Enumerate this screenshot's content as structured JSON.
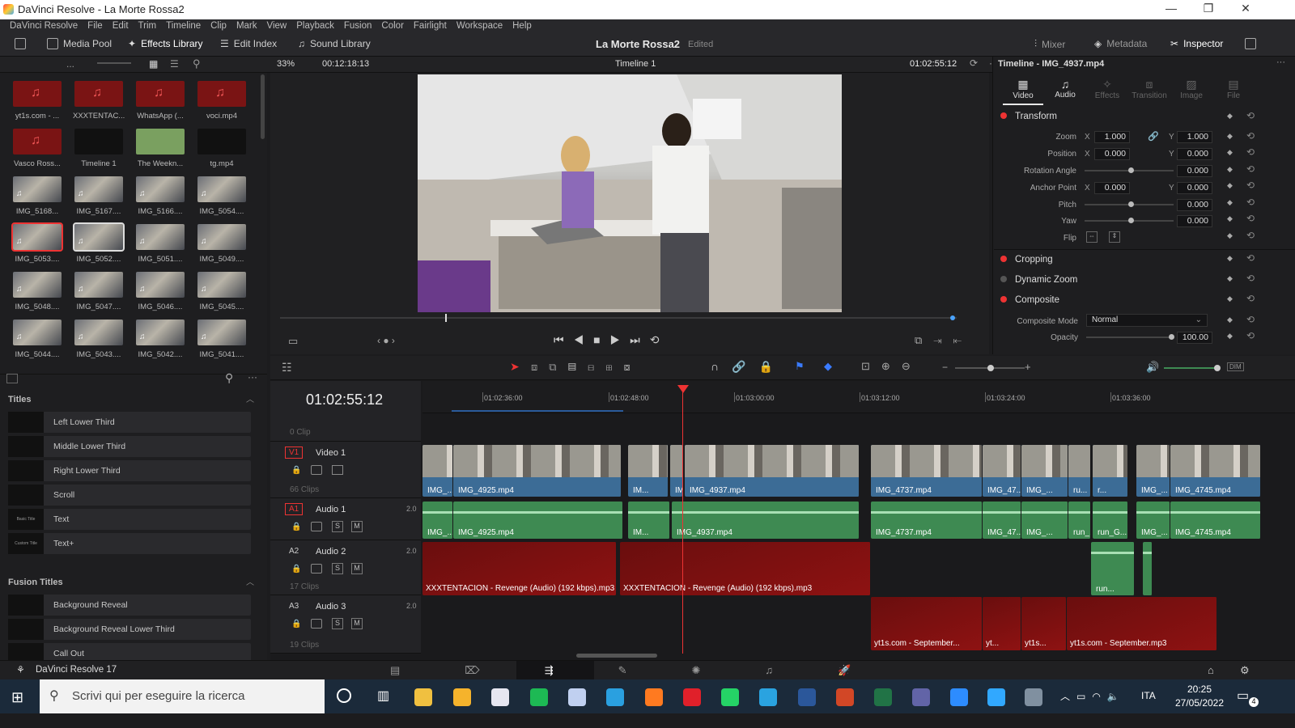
{
  "window": {
    "title": "DaVinci Resolve - La Morte Rossa2",
    "min": "—",
    "max": "❐",
    "close": "✕"
  },
  "menu": [
    "DaVinci Resolve",
    "File",
    "Edit",
    "Trim",
    "Timeline",
    "Clip",
    "Mark",
    "View",
    "Playback",
    "Fusion",
    "Color",
    "Fairlight",
    "Workspace",
    "Help"
  ],
  "toolbar": {
    "media_pool": "Media Pool",
    "effects_library": "Effects Library",
    "edit_index": "Edit Index",
    "sound_library": "Sound Library",
    "project": "La Morte Rossa2",
    "status": "Edited",
    "mixer": "Mixer",
    "metadata": "Metadata",
    "inspector": "Inspector"
  },
  "viewer": {
    "zoom": "33%",
    "duration": "00:12:18:13",
    "timeline_name": "Timeline 1",
    "timecode": "01:02:55:12"
  },
  "inspector": {
    "clip_title": "Timeline - IMG_4937.mp4",
    "tabs": [
      "Video",
      "Audio",
      "Effects",
      "Transition",
      "Image",
      "File"
    ],
    "transform": "Transform",
    "zoom_label": "Zoom",
    "zoom_x": "1.000",
    "zoom_y": "1.000",
    "position_label": "Position",
    "pos_x": "0.000",
    "pos_y": "0.000",
    "rotation_label": "Rotation Angle",
    "rotation": "0.000",
    "anchor_label": "Anchor Point",
    "anchor_x": "0.000",
    "anchor_y": "0.000",
    "pitch_label": "Pitch",
    "pitch": "0.000",
    "yaw_label": "Yaw",
    "yaw": "0.000",
    "flip_label": "Flip",
    "cropping": "Cropping",
    "dynamic_zoom": "Dynamic Zoom",
    "composite": "Composite",
    "composite_mode_label": "Composite Mode",
    "composite_mode": "Normal",
    "opacity_label": "Opacity",
    "opacity": "100.00",
    "x": "X",
    "y": "Y"
  },
  "media": [
    [
      "yt1s.com - ...",
      "XXXTENTAC...",
      "WhatsApp (...",
      "voci.mp4"
    ],
    [
      "Vasco Ross...",
      "Timeline 1",
      "The Weekn...",
      "tg.mp4"
    ],
    [
      "IMG_5168...",
      "IMG_5167....",
      "IMG_5166....",
      "IMG_5054...."
    ],
    [
      "IMG_5053....",
      "IMG_5052....",
      "IMG_5051....",
      "IMG_5049...."
    ],
    [
      "IMG_5048....",
      "IMG_5047....",
      "IMG_5046....",
      "IMG_5045...."
    ],
    [
      "IMG_5044....",
      "IMG_5043....",
      "IMG_5042....",
      "IMG_5041...."
    ]
  ],
  "effects": {
    "titles_header": "Titles",
    "titles": [
      "Left Lower Third",
      "Middle Lower Third",
      "Right Lower Third",
      "Scroll",
      "Text",
      "Text+"
    ],
    "swatches": [
      "",
      "",
      "",
      "",
      "Basic Title",
      "Custom Title"
    ],
    "fusion_header": "Fusion Titles",
    "fusion": [
      "Background Reveal",
      "Background Reveal Lower Third",
      "Call Out"
    ]
  },
  "timeline": {
    "timecode": "01:02:55:12",
    "ruler": [
      "01:02:36:00",
      "01:02:48:00",
      "01:03:00:00",
      "01:03:12:00",
      "01:03:24:00",
      "01:03:36:00"
    ],
    "zero_clip": "0 Clip",
    "tracks": [
      {
        "id": "V1",
        "name": "Video 1",
        "count": "66 Clips",
        "level": ""
      },
      {
        "id": "A1",
        "name": "Audio 1",
        "count": "",
        "level": "2.0"
      },
      {
        "id": "A2",
        "name": "Audio 2",
        "count": "17 Clips",
        "level": "2.0"
      },
      {
        "id": "A3",
        "name": "Audio 3",
        "count": "19 Clips",
        "level": "2.0"
      }
    ],
    "video_clips": [
      "IMG_...",
      "IMG_4925.mp4",
      "IM...",
      "IM...",
      "IMG_4937.mp4",
      "IMG_4737.mp4",
      "IMG_47...",
      "IMG_...",
      "ru...",
      "r...",
      "IMG_...",
      "IMG_4745.mp4"
    ],
    "audio1_clips": [
      "IMG_...",
      "IMG_4925.mp4",
      "IM...",
      "IMG_4937.mp4",
      "IMG_4737.mp4",
      "IMG_47...",
      "IMG_...",
      "run_...",
      "run_G...",
      "IMG_...",
      "IMG_4745.mp4"
    ],
    "audio2_clips": [
      "XXXTENTACION - Revenge (Audio) (192 kbps).mp3",
      "XXXTENTACION - Revenge (Audio) (192 kbps).mp3",
      "run..."
    ],
    "audio3_clips": [
      "yt1s.com - September...",
      "yt...",
      "yt1s...",
      "yt1s.com - September.mp3"
    ],
    "s": "S",
    "m": "M"
  },
  "pagebar": {
    "app": "DaVinci Resolve 17"
  },
  "taskbar": {
    "search": "Scrivi qui per eseguire la ricerca",
    "lang": "ITA",
    "time": "20:25",
    "date": "27/05/2022",
    "notif": "4"
  },
  "colors": {
    "accent_red": "#e33333",
    "video_clip": "#3c6c96",
    "audio_clip": "#3e8a52",
    "music_clip": "#7a1414"
  }
}
